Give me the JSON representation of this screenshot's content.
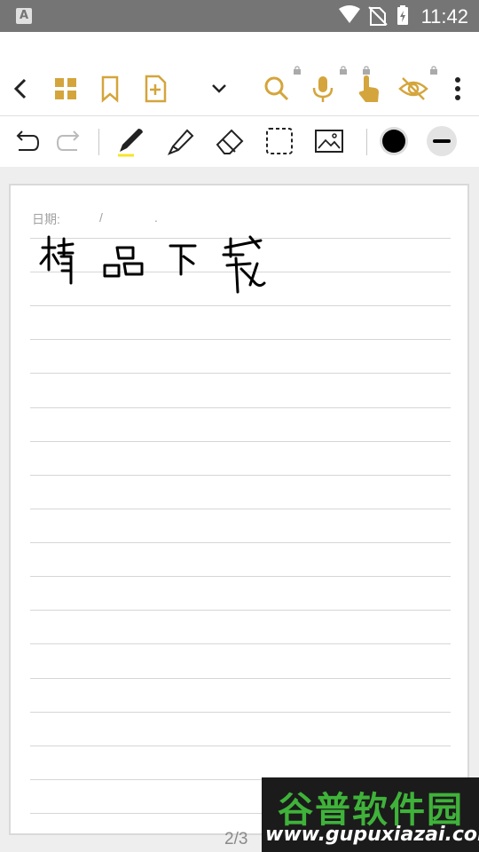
{
  "status_bar": {
    "time": "11:42",
    "app_badge": "A"
  },
  "colors": {
    "accent": "#d4a53c",
    "status_bar": "#757575",
    "rule": "#d6d6d6",
    "pen_color": "#000000"
  },
  "toolbar": {
    "icons": [
      "back-icon",
      "grid-view-icon",
      "bookmark-icon",
      "add-page-icon",
      "chevron-down-icon",
      "search-icon",
      "microphone-icon",
      "touch-icon",
      "hide-icon",
      "more-icon"
    ]
  },
  "drawing_tools": {
    "icons": [
      "undo-icon",
      "redo-icon",
      "pen-icon",
      "highlighter-icon",
      "eraser-icon",
      "lasso-select-icon",
      "image-icon",
      "color-swatch",
      "stroke-width-icon"
    ]
  },
  "page": {
    "date_label": "日期:",
    "date_slash": "/",
    "date_dot": "."
  },
  "page_indicator": "2/3",
  "watermark": {
    "title": "谷普软件园",
    "url": "www.gupuxiazai.com"
  }
}
